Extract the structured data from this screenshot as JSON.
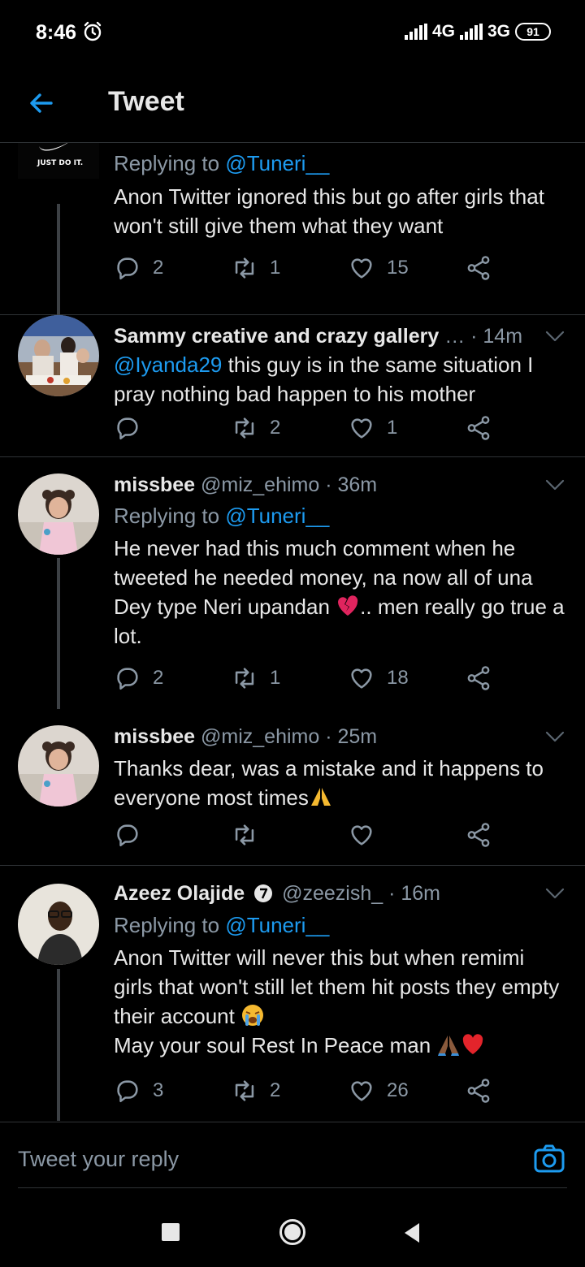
{
  "status": {
    "time": "8:46",
    "network1": "4G",
    "network2": "3G",
    "battery": "91"
  },
  "header": {
    "title": "Tweet"
  },
  "top_tweet": {
    "avatar_text": "JUST DO IT.",
    "replying_prefix": "Replying to ",
    "replying_to": "@Tuneri__",
    "text": "Anon Twitter ignored this but go after girls that won't still give them what they want",
    "replies": "2",
    "retweets": "1",
    "likes": "15"
  },
  "tweets": [
    {
      "name": "Sammy creative and crazy gallery",
      "handle_time": "… · 14m",
      "mention": "@Iyanda29",
      "text": " this guy is in the same situation I pray nothing bad happen to his mother",
      "replies": "",
      "retweets": "2",
      "likes": "1"
    },
    {
      "name": "missbee",
      "handle_time": "@miz_ehimo · 36m",
      "replying_prefix": "Replying to ",
      "replying_to": "@Tuneri__",
      "text_a": "He never had this much comment when he tweeted he needed money, na now all of una Dey type Neri upandan ",
      "text_b": ".. men really go true a lot.",
      "replies": "2",
      "retweets": "1",
      "likes": "18"
    },
    {
      "name": "missbee",
      "handle_time": "@miz_ehimo · 25m",
      "text": "Thanks dear, was a mistake and it happens to everyone most times",
      "replies": "",
      "retweets": "",
      "likes": ""
    },
    {
      "name": "Azeez Olajide",
      "handle_time": "@zeezish_ · 16m",
      "replying_prefix": "Replying to ",
      "replying_to": "@Tuneri__",
      "text_a": "Anon Twitter will never this but when remimi girls that won't still let them hit posts they empty their account ",
      "text_b": "May your soul Rest In Peace man ",
      "replies": "3",
      "retweets": "2",
      "likes": "26"
    }
  ],
  "composer": {
    "placeholder": "Tweet your reply"
  },
  "colors": {
    "accent": "#1d9bf0",
    "muted": "#8b98a5",
    "divider": "#2f3336",
    "heart": "#e0245e"
  },
  "icons": [
    "back-arrow-icon",
    "chevron-down-icon",
    "reply-icon",
    "retweet-icon",
    "like-icon",
    "share-icon",
    "camera-icon",
    "alarm-icon"
  ]
}
